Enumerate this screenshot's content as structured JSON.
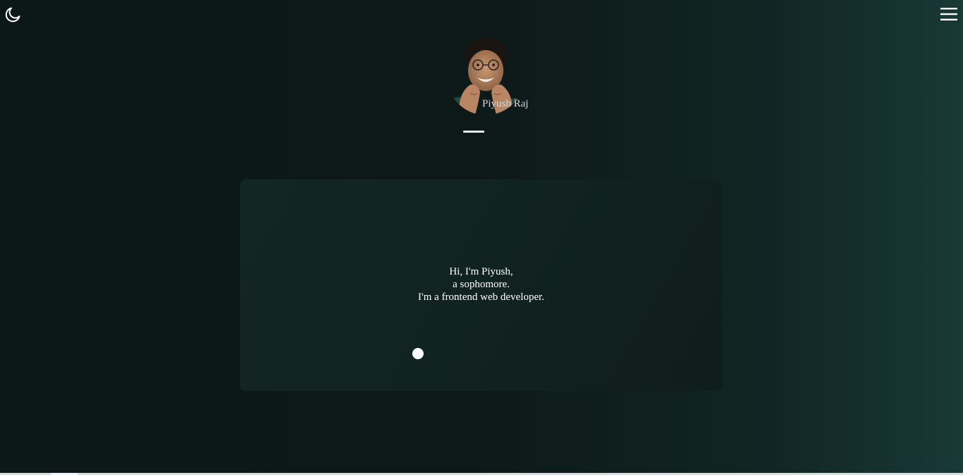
{
  "header": {
    "theme_toggle_icon": "moon-icon",
    "menu_icon": "hamburger-menu-icon"
  },
  "profile": {
    "name": "Piyush Raj",
    "avatar": "profile-photo"
  },
  "hero": {
    "line1": "Hi, I'm Piyush,",
    "line2": "a sophomore.",
    "line3": "I'm a frontend web developer."
  },
  "colors": {
    "background_dark": "#0c1717",
    "background_teal": "#183936",
    "card": "#122624",
    "text": "#ffffff"
  }
}
